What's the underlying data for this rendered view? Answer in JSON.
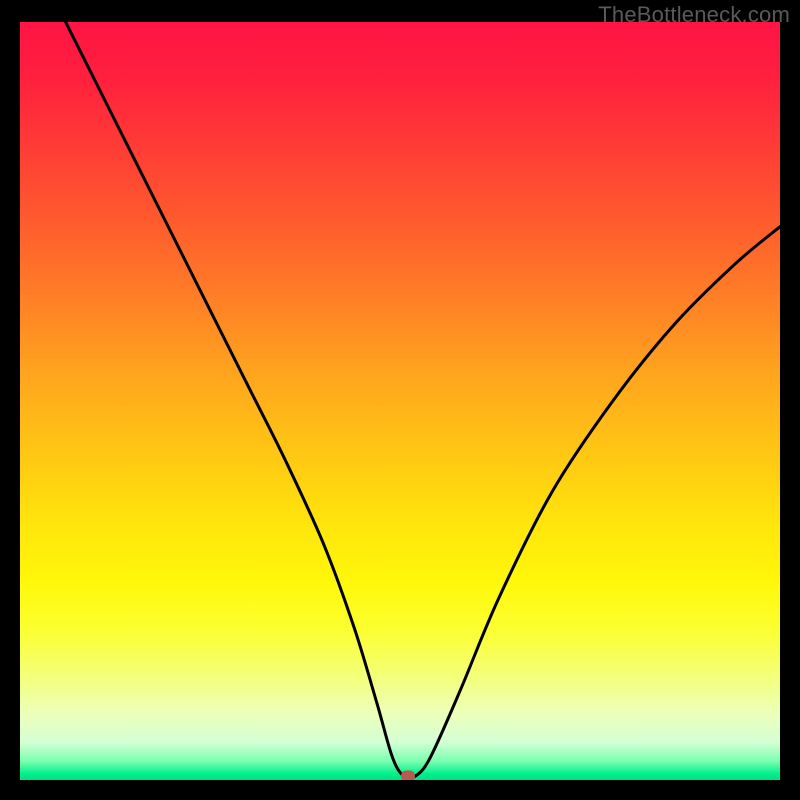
{
  "watermark": "TheBottleneck.com",
  "colors": {
    "frame": "#000000",
    "curve": "#000000",
    "marker": "#b85b4f",
    "gradient_top": "#ff1444",
    "gradient_bottom": "#00e085"
  },
  "chart_data": {
    "type": "line",
    "title": "",
    "xlabel": "",
    "ylabel": "",
    "xlim": [
      0,
      100
    ],
    "ylim": [
      0,
      100
    ],
    "grid": false,
    "legend": false,
    "series": [
      {
        "name": "bottleneck-curve",
        "x": [
          6,
          10,
          15,
          20,
          25,
          30,
          35,
          40,
          44,
          47,
          49,
          50.5,
          52,
          54,
          58,
          63,
          70,
          78,
          86,
          94,
          100
        ],
        "values": [
          100,
          92,
          82,
          72,
          62,
          52,
          42,
          31,
          20,
          10,
          3,
          0.5,
          0.5,
          3,
          12,
          24,
          38,
          50,
          60,
          68,
          73
        ]
      }
    ],
    "marker": {
      "x": 51,
      "y": 0.5
    },
    "annotations": []
  }
}
